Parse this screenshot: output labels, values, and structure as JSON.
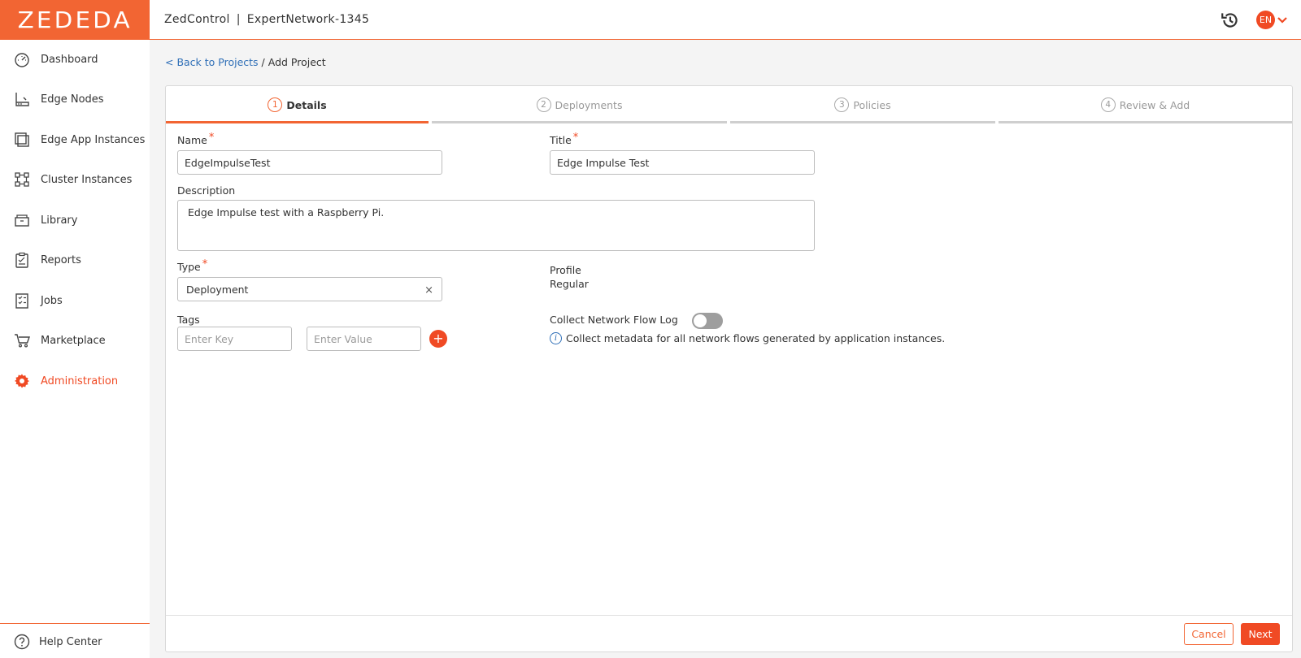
{
  "brand": {
    "logo_text": "ZEDEDA",
    "accent": "#f04a24"
  },
  "header": {
    "product": "ZedControl",
    "separator": "|",
    "enterprise": "ExpertNetwork-1345",
    "lang": "EN",
    "icons": [
      "history-icon",
      "chevron-down-icon"
    ]
  },
  "sidebar": {
    "items": [
      {
        "label": "Dashboard",
        "icon": "dashboard-icon"
      },
      {
        "label": "Edge Nodes",
        "icon": "edge-node-icon"
      },
      {
        "label": "Edge App Instances",
        "icon": "app-instances-icon"
      },
      {
        "label": "Cluster Instances",
        "icon": "cluster-icon"
      },
      {
        "label": "Library",
        "icon": "library-icon"
      },
      {
        "label": "Reports",
        "icon": "reports-icon"
      },
      {
        "label": "Jobs",
        "icon": "jobs-icon"
      },
      {
        "label": "Marketplace",
        "icon": "marketplace-icon"
      },
      {
        "label": "Administration",
        "icon": "gear-icon",
        "active": true
      }
    ],
    "help": {
      "label": "Help Center",
      "icon": "help-icon"
    }
  },
  "breadcrumb": {
    "back": "< Back to Projects",
    "sep": " / ",
    "current": "Add Project"
  },
  "steps": [
    {
      "num": "1",
      "label": "Details",
      "active": true
    },
    {
      "num": "2",
      "label": "Deployments"
    },
    {
      "num": "3",
      "label": "Policies"
    },
    {
      "num": "4",
      "label": "Review & Add"
    }
  ],
  "form": {
    "name": {
      "label": "Name",
      "value": "EdgeImpulseTest",
      "required": "*"
    },
    "title": {
      "label": "Title",
      "value": "Edge Impulse Test",
      "required": "*"
    },
    "description": {
      "label": "Description",
      "value": "Edge Impulse test with a Raspberry Pi."
    },
    "type": {
      "label": "Type",
      "value": "Deployment",
      "required": "*",
      "clear": "×"
    },
    "profile": {
      "label": "Profile",
      "value": "Regular"
    },
    "tags": {
      "label": "Tags",
      "key_placeholder": "Enter Key",
      "value_placeholder": "Enter Value",
      "add": "+"
    },
    "flow_log": {
      "label": "Collect Network Flow Log",
      "enabled": false,
      "info": "Collect metadata for all network flows generated by application instances."
    }
  },
  "footer": {
    "cancel": "Cancel",
    "next": "Next"
  }
}
